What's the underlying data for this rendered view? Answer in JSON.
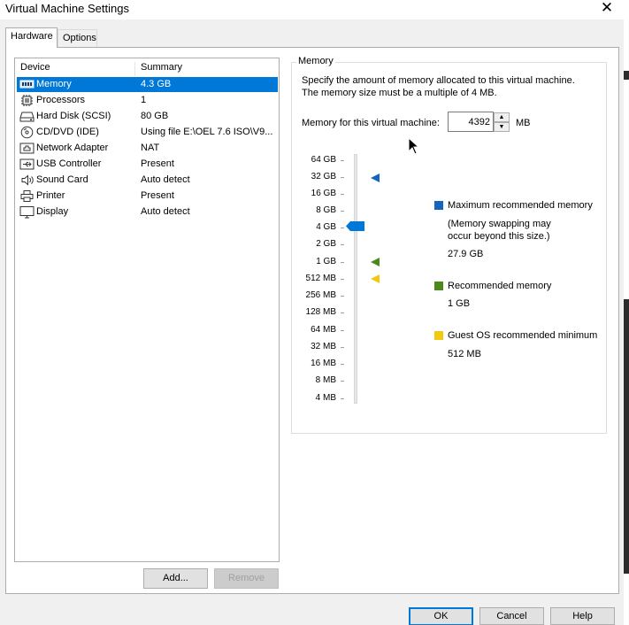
{
  "window": {
    "title": "Virtual Machine Settings",
    "close_glyph": "✕"
  },
  "tabs": [
    {
      "label": "Hardware",
      "active": true
    },
    {
      "label": "Options",
      "active": false
    }
  ],
  "device_list": {
    "headers": {
      "device": "Device",
      "summary": "Summary"
    },
    "items": [
      {
        "name": "Memory",
        "summary": "4.3 GB",
        "icon": "memory-icon",
        "selected": true
      },
      {
        "name": "Processors",
        "summary": "1",
        "icon": "processor-icon"
      },
      {
        "name": "Hard Disk (SCSI)",
        "summary": "80 GB",
        "icon": "hard-disk-icon"
      },
      {
        "name": "CD/DVD (IDE)",
        "summary": "Using file E:\\OEL 7.6 ISO\\V9...",
        "icon": "cd-dvd-icon"
      },
      {
        "name": "Network Adapter",
        "summary": "NAT",
        "icon": "network-adapter-icon"
      },
      {
        "name": "USB Controller",
        "summary": "Present",
        "icon": "usb-icon"
      },
      {
        "name": "Sound Card",
        "summary": "Auto detect",
        "icon": "speaker-icon"
      },
      {
        "name": "Printer",
        "summary": "Present",
        "icon": "printer-icon"
      },
      {
        "name": "Display",
        "summary": "Auto detect",
        "icon": "display-icon"
      }
    ]
  },
  "buttons": {
    "add": "Add...",
    "remove": "Remove",
    "ok": "OK",
    "cancel": "Cancel",
    "help": "Help"
  },
  "memory": {
    "group_title": "Memory",
    "description_line1": "Specify the amount of memory allocated to this virtual machine.",
    "description_line2": "The memory size must be a multiple of 4 MB.",
    "field_label": "Memory for this virtual machine:",
    "value": "4392",
    "unit": "MB",
    "scale_labels": [
      "64 GB",
      "32 GB",
      "16 GB",
      "8 GB",
      "4 GB",
      "2 GB",
      "1 GB",
      "512 MB",
      "256 MB",
      "128 MB",
      "64 MB",
      "32 MB",
      "16 MB",
      "8 MB",
      "4 MB"
    ],
    "legend": {
      "max": {
        "label": "Maximum recommended memory",
        "note_line1": "(Memory swapping may",
        "note_line2": "occur beyond this size.)",
        "value": "27.9 GB"
      },
      "recommended": {
        "label": "Recommended memory",
        "value": "1 GB"
      },
      "guest_min": {
        "label": "Guest OS recommended minimum",
        "value": "512 MB"
      }
    }
  },
  "colors": {
    "selection": "#0078d7",
    "slider_thumb": "#0078d7",
    "max_marker": "#1565c0",
    "recommended_marker": "#4a8a1c",
    "guest_min_marker": "#f2c811"
  }
}
